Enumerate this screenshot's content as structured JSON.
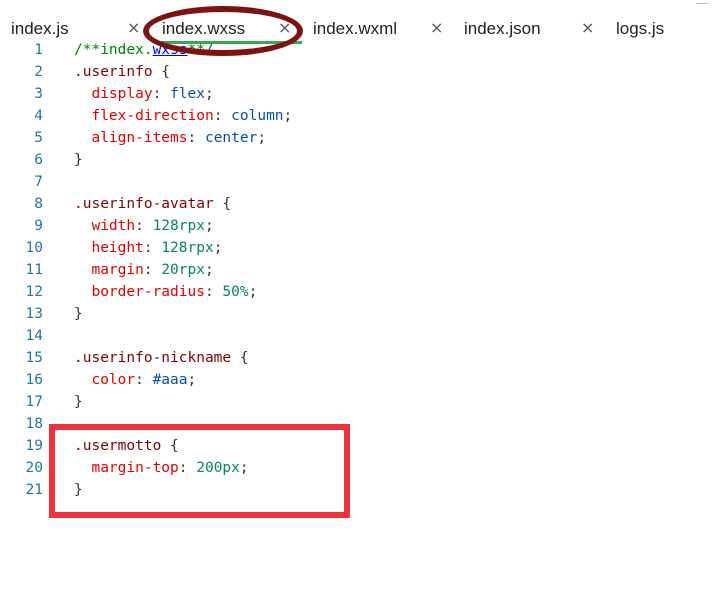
{
  "tabs": [
    {
      "label": "index.js",
      "close": "×",
      "active": false
    },
    {
      "label": "index.wxss",
      "close": "×",
      "active": true
    },
    {
      "label": "index.wxml",
      "close": "×",
      "active": false
    },
    {
      "label": "index.json",
      "close": "×",
      "active": false
    },
    {
      "label": "logs.js",
      "close": "×",
      "active": false
    }
  ],
  "code": {
    "lines": [
      {
        "n": "1",
        "tokens": [
          {
            "t": "/**index.",
            "c": "comment"
          },
          {
            "t": "wxss",
            "c": "comment-link"
          },
          {
            "t": "**/",
            "c": "comment"
          }
        ]
      },
      {
        "n": "2",
        "tokens": [
          {
            "t": ".userinfo",
            "c": "sel"
          },
          {
            "t": " {",
            "c": "punct"
          }
        ]
      },
      {
        "n": "3",
        "tokens": [
          {
            "t": "  display",
            "c": "prop"
          },
          {
            "t": ": ",
            "c": "punct"
          },
          {
            "t": "flex",
            "c": "val"
          },
          {
            "t": ";",
            "c": "punct"
          }
        ]
      },
      {
        "n": "4",
        "tokens": [
          {
            "t": "  flex-direction",
            "c": "prop"
          },
          {
            "t": ": ",
            "c": "punct"
          },
          {
            "t": "column",
            "c": "val"
          },
          {
            "t": ";",
            "c": "punct"
          }
        ]
      },
      {
        "n": "5",
        "tokens": [
          {
            "t": "  align-items",
            "c": "prop"
          },
          {
            "t": ": ",
            "c": "punct"
          },
          {
            "t": "center",
            "c": "val"
          },
          {
            "t": ";",
            "c": "punct"
          }
        ]
      },
      {
        "n": "6",
        "tokens": [
          {
            "t": "}",
            "c": "punct"
          }
        ]
      },
      {
        "n": "7",
        "tokens": []
      },
      {
        "n": "8",
        "tokens": [
          {
            "t": ".userinfo-avatar",
            "c": "sel"
          },
          {
            "t": " {",
            "c": "punct"
          }
        ]
      },
      {
        "n": "9",
        "tokens": [
          {
            "t": "  width",
            "c": "prop"
          },
          {
            "t": ": ",
            "c": "punct"
          },
          {
            "t": "128rpx",
            "c": "num"
          },
          {
            "t": ";",
            "c": "punct"
          }
        ]
      },
      {
        "n": "10",
        "tokens": [
          {
            "t": "  height",
            "c": "prop"
          },
          {
            "t": ": ",
            "c": "punct"
          },
          {
            "t": "128rpx",
            "c": "num"
          },
          {
            "t": ";",
            "c": "punct"
          }
        ]
      },
      {
        "n": "11",
        "tokens": [
          {
            "t": "  margin",
            "c": "prop"
          },
          {
            "t": ": ",
            "c": "punct"
          },
          {
            "t": "20rpx",
            "c": "num"
          },
          {
            "t": ";",
            "c": "punct"
          }
        ]
      },
      {
        "n": "12",
        "tokens": [
          {
            "t": "  border-radius",
            "c": "prop"
          },
          {
            "t": ": ",
            "c": "punct"
          },
          {
            "t": "50%",
            "c": "num"
          },
          {
            "t": ";",
            "c": "punct"
          }
        ]
      },
      {
        "n": "13",
        "tokens": [
          {
            "t": "}",
            "c": "punct"
          }
        ]
      },
      {
        "n": "14",
        "tokens": []
      },
      {
        "n": "15",
        "tokens": [
          {
            "t": ".userinfo-nickname",
            "c": "sel"
          },
          {
            "t": " {",
            "c": "punct"
          }
        ]
      },
      {
        "n": "16",
        "tokens": [
          {
            "t": "  color",
            "c": "prop"
          },
          {
            "t": ": ",
            "c": "punct"
          },
          {
            "t": "#aaa",
            "c": "val"
          },
          {
            "t": ";",
            "c": "punct"
          }
        ]
      },
      {
        "n": "17",
        "tokens": [
          {
            "t": "}",
            "c": "punct"
          }
        ]
      },
      {
        "n": "18",
        "tokens": []
      },
      {
        "n": "19",
        "tokens": [
          {
            "t": ".usermotto",
            "c": "sel"
          },
          {
            "t": " {",
            "c": "punct"
          }
        ]
      },
      {
        "n": "20",
        "tokens": [
          {
            "t": "  margin-top",
            "c": "prop"
          },
          {
            "t": ": ",
            "c": "punct"
          },
          {
            "t": "200px",
            "c": "num"
          },
          {
            "t": ";",
            "c": "punct"
          }
        ]
      },
      {
        "n": "21",
        "tokens": [
          {
            "t": "}",
            "c": "punct"
          }
        ]
      }
    ]
  },
  "colors": {
    "line_number": "#237893",
    "selector": "#800000",
    "property": "#e50000",
    "value": "#0451a5",
    "number": "#098658",
    "active_tab_underline": "#3aa757",
    "tab_annotation_ellipse": "#7d1212",
    "code_annotation_box": "#f0333b"
  }
}
